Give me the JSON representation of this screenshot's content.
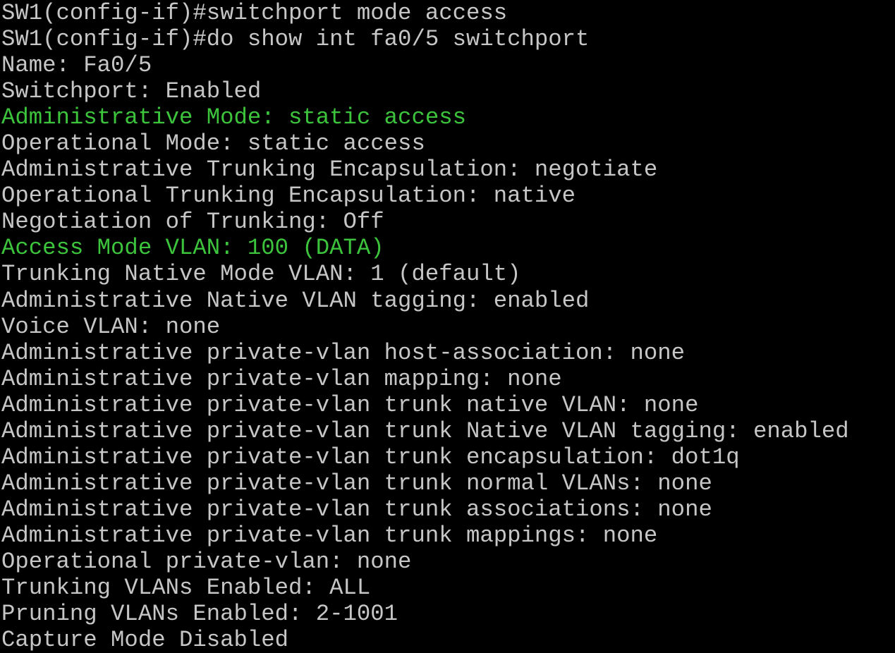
{
  "colors": {
    "background": "#000000",
    "text": "#c6c6c6",
    "highlight": "#3cc43c"
  },
  "terminal": {
    "lines": [
      {
        "text": "SW1(config-if)#switchport mode access",
        "highlight": false
      },
      {
        "text": "SW1(config-if)#do show int fa0/5 switchport",
        "highlight": false
      },
      {
        "text": "Name: Fa0/5",
        "highlight": false
      },
      {
        "text": "Switchport: Enabled",
        "highlight": false
      },
      {
        "text": "Administrative Mode: static access",
        "highlight": true
      },
      {
        "text": "Operational Mode: static access",
        "highlight": false
      },
      {
        "text": "Administrative Trunking Encapsulation: negotiate",
        "highlight": false
      },
      {
        "text": "Operational Trunking Encapsulation: native",
        "highlight": false
      },
      {
        "text": "Negotiation of Trunking: Off",
        "highlight": false
      },
      {
        "text": "Access Mode VLAN: 100 (DATA)",
        "highlight": true
      },
      {
        "text": "Trunking Native Mode VLAN: 1 (default)",
        "highlight": false
      },
      {
        "text": "Administrative Native VLAN tagging: enabled",
        "highlight": false
      },
      {
        "text": "Voice VLAN: none",
        "highlight": false
      },
      {
        "text": "Administrative private-vlan host-association: none",
        "highlight": false
      },
      {
        "text": "Administrative private-vlan mapping: none",
        "highlight": false
      },
      {
        "text": "Administrative private-vlan trunk native VLAN: none",
        "highlight": false
      },
      {
        "text": "Administrative private-vlan trunk Native VLAN tagging: enabled",
        "highlight": false
      },
      {
        "text": "Administrative private-vlan trunk encapsulation: dot1q",
        "highlight": false
      },
      {
        "text": "Administrative private-vlan trunk normal VLANs: none",
        "highlight": false
      },
      {
        "text": "Administrative private-vlan trunk associations: none",
        "highlight": false
      },
      {
        "text": "Administrative private-vlan trunk mappings: none",
        "highlight": false
      },
      {
        "text": "Operational private-vlan: none",
        "highlight": false
      },
      {
        "text": "Trunking VLANs Enabled: ALL",
        "highlight": false
      },
      {
        "text": "Pruning VLANs Enabled: 2-1001",
        "highlight": false
      },
      {
        "text": "Capture Mode Disabled",
        "highlight": false
      }
    ]
  }
}
